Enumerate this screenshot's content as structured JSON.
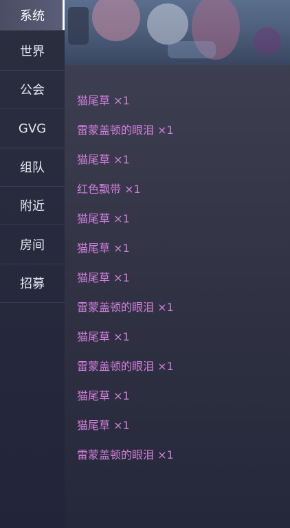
{
  "sidebar": {
    "tabs": [
      {
        "label": "系统",
        "active": true
      },
      {
        "label": "世界",
        "active": false
      },
      {
        "label": "公会",
        "active": false
      },
      {
        "label": "GVG",
        "active": false
      },
      {
        "label": "组队",
        "active": false
      },
      {
        "label": "附近",
        "active": false
      },
      {
        "label": "房间",
        "active": false
      },
      {
        "label": "招募",
        "active": false
      }
    ]
  },
  "messages": [
    "猫尾草 ×1",
    "雷蒙盖顿的眼泪 ×1",
    "猫尾草 ×1",
    "红色飘带 ×1",
    "猫尾草 ×1",
    "猫尾草 ×1",
    "猫尾草 ×1",
    "雷蒙盖顿的眼泪 ×1",
    "猫尾草 ×1",
    "雷蒙盖顿的眼泪 ×1",
    "猫尾草 ×1",
    "猫尾草 ×1",
    "雷蒙盖顿的眼泪 ×1"
  ],
  "colors": {
    "message_text": "#d27fdd",
    "panel_bg": "#2f3142",
    "tab_active_bg": "#5b5e78"
  }
}
